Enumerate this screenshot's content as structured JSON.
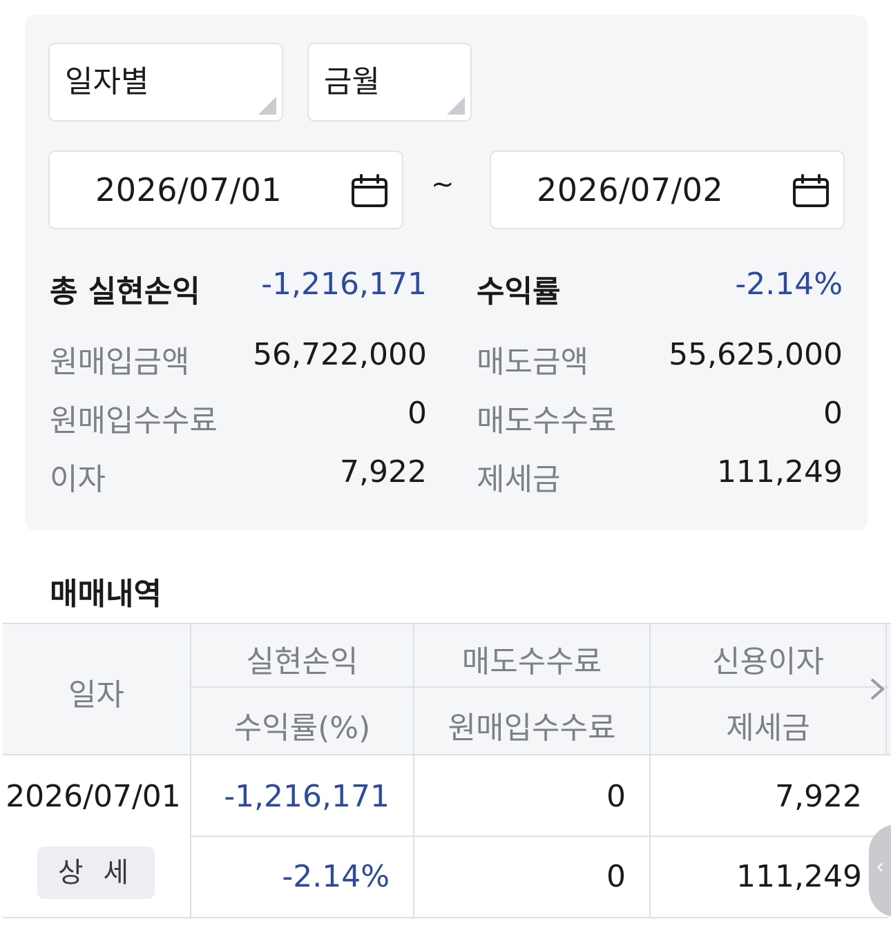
{
  "filters": {
    "period_type": "일자별",
    "product_type": "금월",
    "start_date": "2026/07/01",
    "end_date": "2026/07/02",
    "range_separator": "~"
  },
  "summary": {
    "total_pnl_label": "총 실현손익",
    "total_pnl_value": "-1,216,171",
    "return_label": "수익률",
    "return_value": "-2.14%",
    "buy_amount_label": "원매입금액",
    "buy_amount_value": "56,722,000",
    "sell_amount_label": "매도금액",
    "sell_amount_value": "55,625,000",
    "buy_fee_label": "원매입수수료",
    "buy_fee_value": "0",
    "sell_fee_label": "매도수수료",
    "sell_fee_value": "0",
    "interest_label": "이자",
    "interest_value": "7,922",
    "tax_label": "제세금",
    "tax_value": "111,249"
  },
  "history": {
    "title": "매매내역",
    "headers": {
      "date": "일자",
      "pnl": "실현손익",
      "return_pct": "수익률(%)",
      "sell_fee": "매도수수료",
      "buy_fee": "원매입수수료",
      "credit_interest": "신용이자",
      "tax": "제세금"
    },
    "rows": [
      {
        "date": "2026/07/01",
        "detail_label": "상 세",
        "pnl": "-1,216,171",
        "return_pct": "-2.14%",
        "sell_fee": "0",
        "buy_fee": "0",
        "credit_interest": "7,922",
        "tax": "111,249"
      }
    ]
  },
  "icons": {
    "calendar": "calendar-icon",
    "scroll_right": "chevron-right-icon",
    "side_handle": "chevron-left-icon"
  },
  "colors": {
    "negative": "#2a4aa6",
    "panel_bg": "#f5f6f8"
  }
}
